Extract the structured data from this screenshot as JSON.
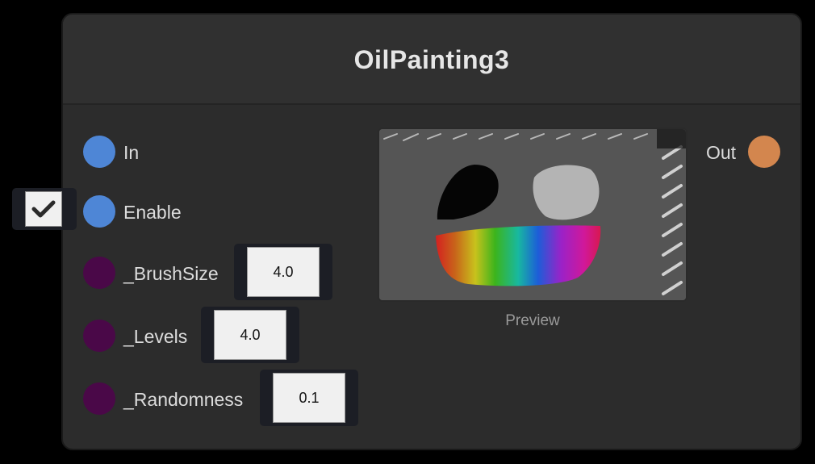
{
  "node": {
    "title": "OilPainting3",
    "inputs": [
      {
        "label": "In"
      },
      {
        "label": "Enable"
      },
      {
        "label": "_BrushSize",
        "value": "4.0"
      },
      {
        "label": "_Levels",
        "value": "4.0"
      },
      {
        "label": "_Randomness",
        "value": "0.1"
      }
    ],
    "enable_checked": true,
    "output": {
      "label": "Out"
    },
    "preview_label": "Preview"
  },
  "colors": {
    "port_in": "#4e86d6",
    "port_param": "#4a0848",
    "port_out": "#d3864e"
  },
  "icons": {
    "checkbox": "checkmark-icon"
  }
}
